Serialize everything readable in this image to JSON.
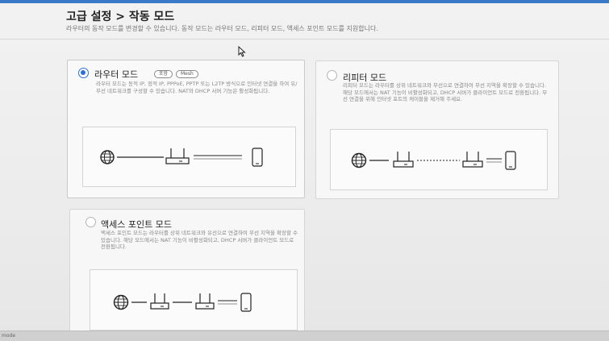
{
  "header": {
    "title": "고급 설정 > 작동 모드",
    "subtitle": "라우터의 동작 모드를 변경할 수 있습니다. 동작 모드는 라우터 모드, 리피터 모드, 액세스 포인트 모드를 지원합니다."
  },
  "modes": {
    "router": {
      "title": "라우터 모드",
      "badges": [
        "포함",
        "Mesh"
      ],
      "selected": true,
      "description": "라우터 모드는 동적 IP, 정적 IP, PPPoE, PPTP 또는 L2TP 방식으로 인터넷 연결을 하여 유/무선 네트워크를 구성할 수 있습니다. NAT와 DHCP 서버 기능은 활성화됩니다."
    },
    "repeater": {
      "title": "리피터 모드",
      "selected": false,
      "description": "리피터 모드는 라우터를 상위 네트워크와 무선으로 연결하여 무선 지역을 확장할 수 있습니다. 해당 모드에서는 NAT 기능이 비활성화되고, DHCP 서버가 클라이언트 모드로 전환됩니다. 무선 연결을 위해 인터넷 포트의 케이블을 제거해 주세요."
    },
    "access_point": {
      "title": "액세스 포인트 모드",
      "selected": false,
      "description": "액세스 포인트 모드는 라우터를 상위 네트워크와 유선으로 연결하여 무선 지역을 확장할 수 있습니다. 해당 모드에서는 NAT 기능이 비활성화되고, DHCP 서버가 클라이언트 모드로 전환됩니다."
    }
  },
  "status_bar": {
    "text": "mode"
  },
  "colors": {
    "accent": "#2f6fd6",
    "topbar": "#3a78c8"
  },
  "icons": [
    "globe-icon",
    "router-icon",
    "phone-icon",
    "cursor-icon"
  ]
}
